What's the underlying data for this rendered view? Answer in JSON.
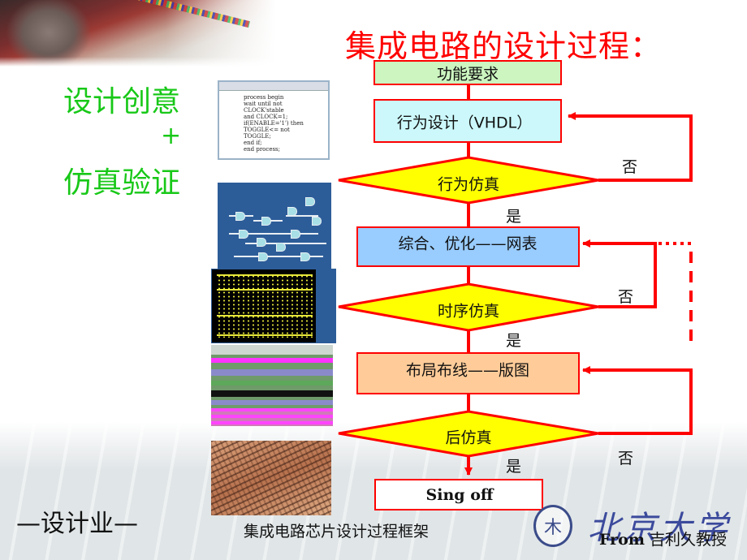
{
  "slide": {
    "title": "集成电路的设计过程：",
    "left_text": {
      "line1": "设计创意",
      "plus": "+",
      "line2": "仿真验证"
    },
    "code_thumbnail": {
      "lines": [
        "process begin",
        "wait until not",
        "CLOCK'stable",
        "and CLOCK=1;",
        "if(ENABLE='1') then",
        "TOGGLE<= not",
        "TOGGLE;",
        "end if;",
        "end process;"
      ]
    },
    "flowchart": {
      "nodes": [
        {
          "id": "req",
          "type": "process",
          "label": "功能要求",
          "fill": "#ccf5c0"
        },
        {
          "id": "behav",
          "type": "process",
          "label": "行为设计（VHDL）",
          "fill": "#ccf8fb"
        },
        {
          "id": "behav_sim",
          "type": "decision",
          "label": "行为仿真",
          "fill": "#ffff00"
        },
        {
          "id": "synth",
          "type": "process",
          "label": "综合、优化——网表",
          "fill": "#99ccff"
        },
        {
          "id": "timing_sim",
          "type": "decision",
          "label": "时序仿真",
          "fill": "#ffff00"
        },
        {
          "id": "pnr",
          "type": "process",
          "label": "布局布线——版图",
          "fill": "#ffcc99"
        },
        {
          "id": "post_sim",
          "type": "decision",
          "label": "后仿真",
          "fill": "#ffff00"
        },
        {
          "id": "signoff",
          "type": "process",
          "label": "Sing off",
          "fill": "#ffffff"
        }
      ],
      "yes_label": "是",
      "no_label": "否",
      "line_color": "#ff0000"
    },
    "footer": {
      "left": "—设计业—",
      "caption": "集成电路芯片设计过程框架",
      "logo_text": "北京大学",
      "credit_from": "From",
      "credit_name": " 吉利久教授"
    }
  }
}
